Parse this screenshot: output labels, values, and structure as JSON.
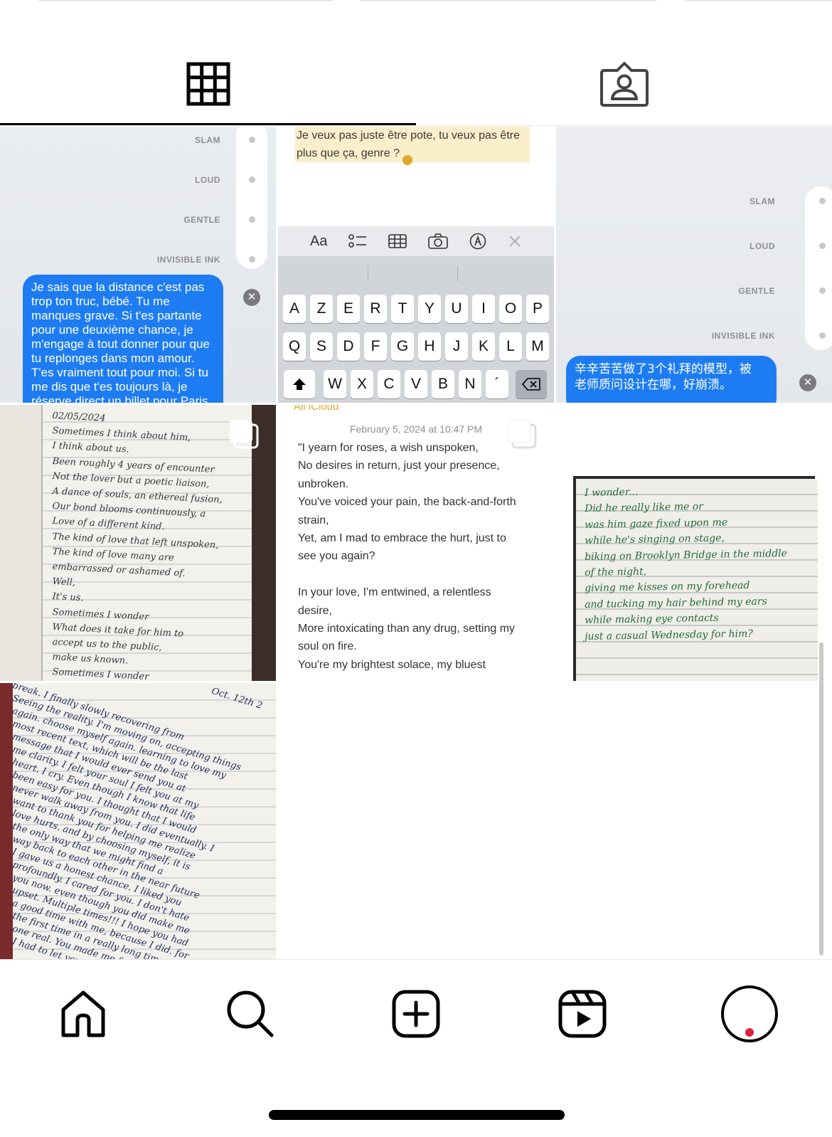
{
  "tabs": [
    {
      "icon": "grid-icon",
      "active": true
    },
    {
      "icon": "tagged-person-icon",
      "active": false
    }
  ],
  "post1": {
    "effects": [
      "SLAM",
      "LOUD",
      "GENTLE",
      "INVISIBLE INK"
    ],
    "message": [
      "Je sais que la distance c'est pas",
      "trop ton truc, bébé. Tu me",
      "manques grave. Si t'es partante",
      "pour une deuxième chance, je",
      "m'engage à tout donner pour que",
      "tu replonges dans mon amour.",
      "T'es vraiment tout pour moi. Si tu",
      "me dis que t'es toujours là, je",
      "réserve direct un billet pour Paris"
    ]
  },
  "post2": {
    "note": [
      "Je veux pas juste être pote, tu veux pas être",
      "plus que ça, genre ?"
    ],
    "toolbar": {
      "format": "Aa"
    },
    "keyboard": {
      "row1": [
        "A",
        "Z",
        "E",
        "R",
        "T",
        "Y",
        "U",
        "I",
        "O",
        "P"
      ],
      "row2": [
        "Q",
        "S",
        "D",
        "F",
        "G",
        "H",
        "J",
        "K",
        "L",
        "M"
      ],
      "row3": [
        "W",
        "X",
        "C",
        "V",
        "B",
        "N",
        "´"
      ]
    }
  },
  "post3": {
    "effects": [
      "SLAM",
      "LOUD",
      "GENTLE",
      "INVISIBLE INK"
    ],
    "message": [
      "辛辛苦苦做了3个礼拜的模型，被",
      "老师质问设计在哪，好崩溃。"
    ]
  },
  "post4": {
    "handwriting": [
      "02/05/2024",
      "Sometimes I think about him,",
      "I think about us.",
      "Been roughly 4 years of encounter",
      "Not the lover but a poetic liaison,",
      "A dance of souls, an ethereal fusion,",
      "Our bond blooms continuously, a",
      "Love of a different kind.",
      "The kind of love that left unspoken,",
      "The kind of love many are",
      "embarrassed or ashamed of.",
      "Well,",
      "It's us.",
      "Sometimes I wonder",
      "What does it take for him to",
      "accept us to the public,",
      "make us known.",
      "Sometimes I wonder"
    ]
  },
  "post5": {
    "back_label": "All iCloud",
    "date": "February 5, 2024 at 10:47 PM",
    "lines": [
      "\"I yearn for roses, a wish unspoken,",
      "No desires in return, just your presence,",
      "unbroken.",
      "You've voiced your pain, the back-and-forth",
      "strain,",
      "Yet, am I mad to embrace the hurt, just to",
      "see you again?",
      "",
      "In your love, I'm entwined, a relentless",
      "desire,",
      "More intoxicating than any drug, setting my",
      "soul on fire.",
      "You're my brightest solace, my bluest"
    ]
  },
  "post6": {
    "handwriting": [
      "I wonder...",
      "Did he really like me or",
      "was him gaze fixed upon me",
      "while he's singing on stage,",
      "biking on Brooklyn Bridge in the middle",
      "of the night,",
      "giving me kisses on my forehead",
      "and tucking my hair behind my ears",
      "while making eye contacts",
      "just a casual Wednesday for him?"
    ]
  },
  "post7": {
    "date": "Oct. 12th 2",
    "handwriting": [
      "break. I finally slowly recovering from",
      "Seeing the reality. I'm moving on, accepting things",
      "again. choose myself again. learning to love my",
      "most recent text, which will be the last",
      "message that I would ever send you at",
      "me clarity. I felt your soul I felt you at my",
      "heart. I cry. Even though I know that life",
      "been easy for you. I thought that I would",
      "never walk away from you. I did eventually. I",
      "want to thank you for helping me realize",
      "love hurts. and by choosing myself, it is",
      "the only way that we might find a",
      "way back to each other in the near future",
      "I gave us a honest chance. I liked you",
      "profoundly. I cared for you. I don't hate",
      "you now. even though you did make me",
      "upset. Multiple times!!! I hope you had",
      "a good time with me, because I did. for",
      "the first time in a really long time. I felt",
      "one real. You made me feel something. It was",
      "I had to let you go. Goodbye"
    ]
  },
  "bottom_nav": [
    "home-icon",
    "search-icon",
    "create-icon",
    "reels-icon",
    "profile-avatar"
  ],
  "colors": {
    "imessage_blue": "#1e7cf2",
    "notes_highlight": "#fbeecb",
    "notes_accent": "#e0a92a",
    "notification_dot": "#e0213a"
  }
}
